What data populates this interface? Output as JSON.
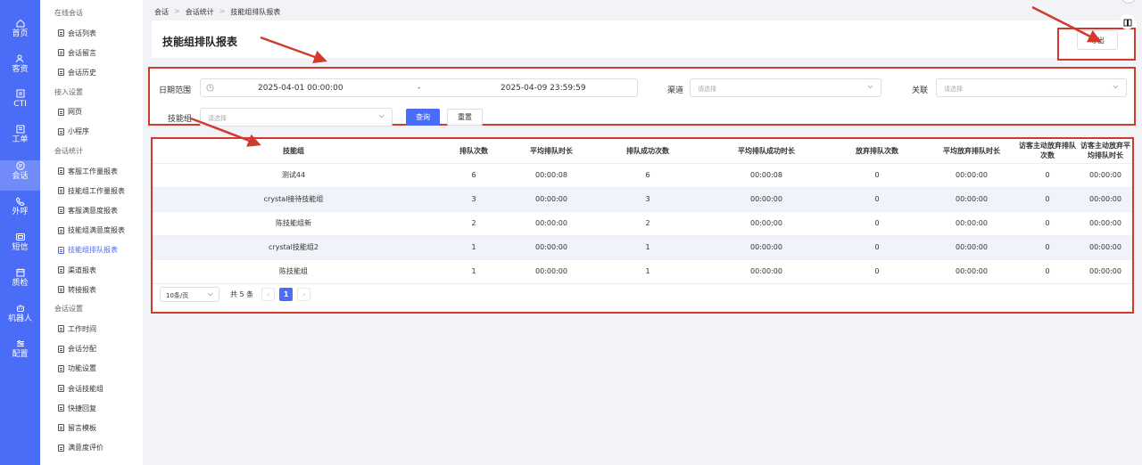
{
  "rail": [
    {
      "label": "首页",
      "icon": "home-icon"
    },
    {
      "label": "客资",
      "icon": "users-icon"
    },
    {
      "label": "CTI",
      "icon": "cti-icon"
    },
    {
      "label": "工单",
      "icon": "ticket-icon"
    },
    {
      "label": "会话",
      "icon": "chat-icon",
      "active": true
    },
    {
      "label": "外呼",
      "icon": "phone-icon"
    },
    {
      "label": "短信",
      "icon": "sms-icon"
    },
    {
      "label": "质检",
      "icon": "calendar-icon"
    },
    {
      "label": "机器人",
      "icon": "robot-icon"
    },
    {
      "label": "配置",
      "icon": "settings-icon"
    }
  ],
  "submenu": {
    "groups": [
      {
        "title": "在线会话",
        "items": [
          "会话列表",
          "会话留言",
          "会话历史"
        ]
      },
      {
        "title": "接入设置",
        "items": [
          "网页",
          "小程序"
        ]
      },
      {
        "title": "会话统计",
        "items": [
          "客服工作量报表",
          "技能组工作量报表",
          "客服满意度报表",
          "技能组满意度报表",
          "技能组排队报表",
          "渠道报表",
          "转接报表"
        ]
      },
      {
        "title": "会话设置",
        "items": [
          "工作时间",
          "会话分配",
          "功能设置",
          "会话技能组",
          "快捷回复",
          "留言模板",
          "满意度评价"
        ]
      }
    ],
    "active_item": "技能组排队报表"
  },
  "breadcrumb": [
    "会话",
    "会话统计",
    "技能组排队报表"
  ],
  "page_title": "技能组排队报表",
  "export_label": "导出",
  "filters": {
    "date_label": "日期范围",
    "date_start": "2025-04-01 00:00:00",
    "date_sep": "-",
    "date_end": "2025-04-09 23:59:59",
    "channel_label": "渠道",
    "channel_placeholder": "请选择",
    "relation_label": "关联",
    "relation_placeholder": "请选择",
    "skill_label": "技能组",
    "skill_placeholder": "请选择",
    "query_label": "查询",
    "reset_label": "重置"
  },
  "table": {
    "columns": [
      "技能组",
      "排队次数",
      "平均排队时长",
      "排队成功次数",
      "平均排队成功时长",
      "放弃排队次数",
      "平均放弃排队时长",
      "访客主动放弃排队次数",
      "访客主动放弃平均排队时长"
    ],
    "rows": [
      [
        "测试44",
        "6",
        "00:00:08",
        "6",
        "00:00:08",
        "0",
        "00:00:00",
        "0",
        "00:00:00"
      ],
      [
        "crystal接待技能组",
        "3",
        "00:00:00",
        "3",
        "00:00:00",
        "0",
        "00:00:00",
        "0",
        "00:00:00"
      ],
      [
        "陈技能组新",
        "2",
        "00:00:00",
        "2",
        "00:00:00",
        "0",
        "00:00:00",
        "0",
        "00:00:00"
      ],
      [
        "crystal技能组2",
        "1",
        "00:00:00",
        "1",
        "00:00:00",
        "0",
        "00:00:00",
        "0",
        "00:00:00"
      ],
      [
        "陈技能组",
        "1",
        "00:00:00",
        "1",
        "00:00:00",
        "0",
        "00:00:00",
        "0",
        "00:00:00"
      ]
    ]
  },
  "pagination": {
    "page_size": "10条/页",
    "total": "共 5 条",
    "prev": "‹",
    "current": "1",
    "next": "›"
  },
  "colors": {
    "accent": "#4a6cf7",
    "highlight": "#d23a2e"
  }
}
